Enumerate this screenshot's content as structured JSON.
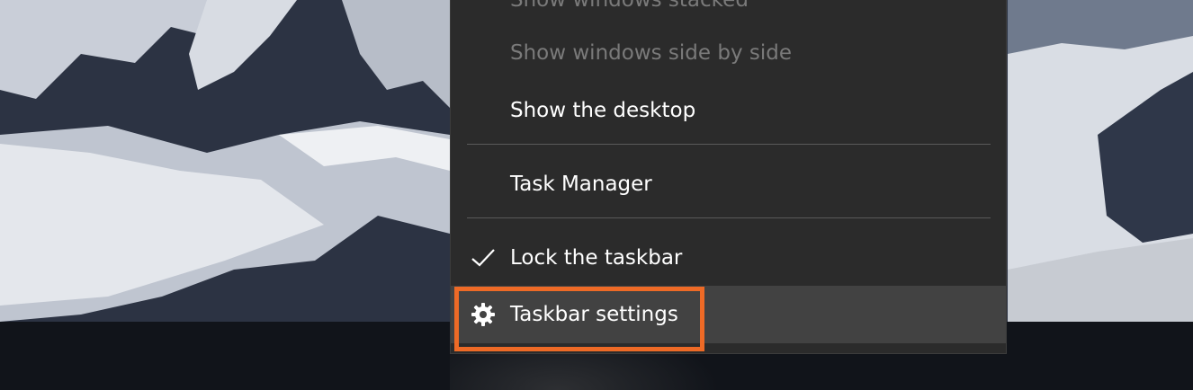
{
  "menu": {
    "items": [
      {
        "label": "Show windows stacked",
        "enabled": false
      },
      {
        "label": "Show windows side by side",
        "enabled": false
      },
      {
        "label": "Show the desktop",
        "enabled": true
      },
      {
        "label": "Task Manager",
        "enabled": true
      },
      {
        "label": "Lock the taskbar",
        "enabled": true,
        "checked": true,
        "icon": "checkmark-icon"
      },
      {
        "label": "Taskbar settings",
        "enabled": true,
        "hovered": true,
        "icon": "gear-icon"
      }
    ]
  },
  "colors": {
    "menu_background": "#2b2b2b",
    "menu_hover": "#424242",
    "disabled_text": "#7a7a7a",
    "highlight_border": "#ee6a26",
    "taskbar": "#11141a"
  }
}
